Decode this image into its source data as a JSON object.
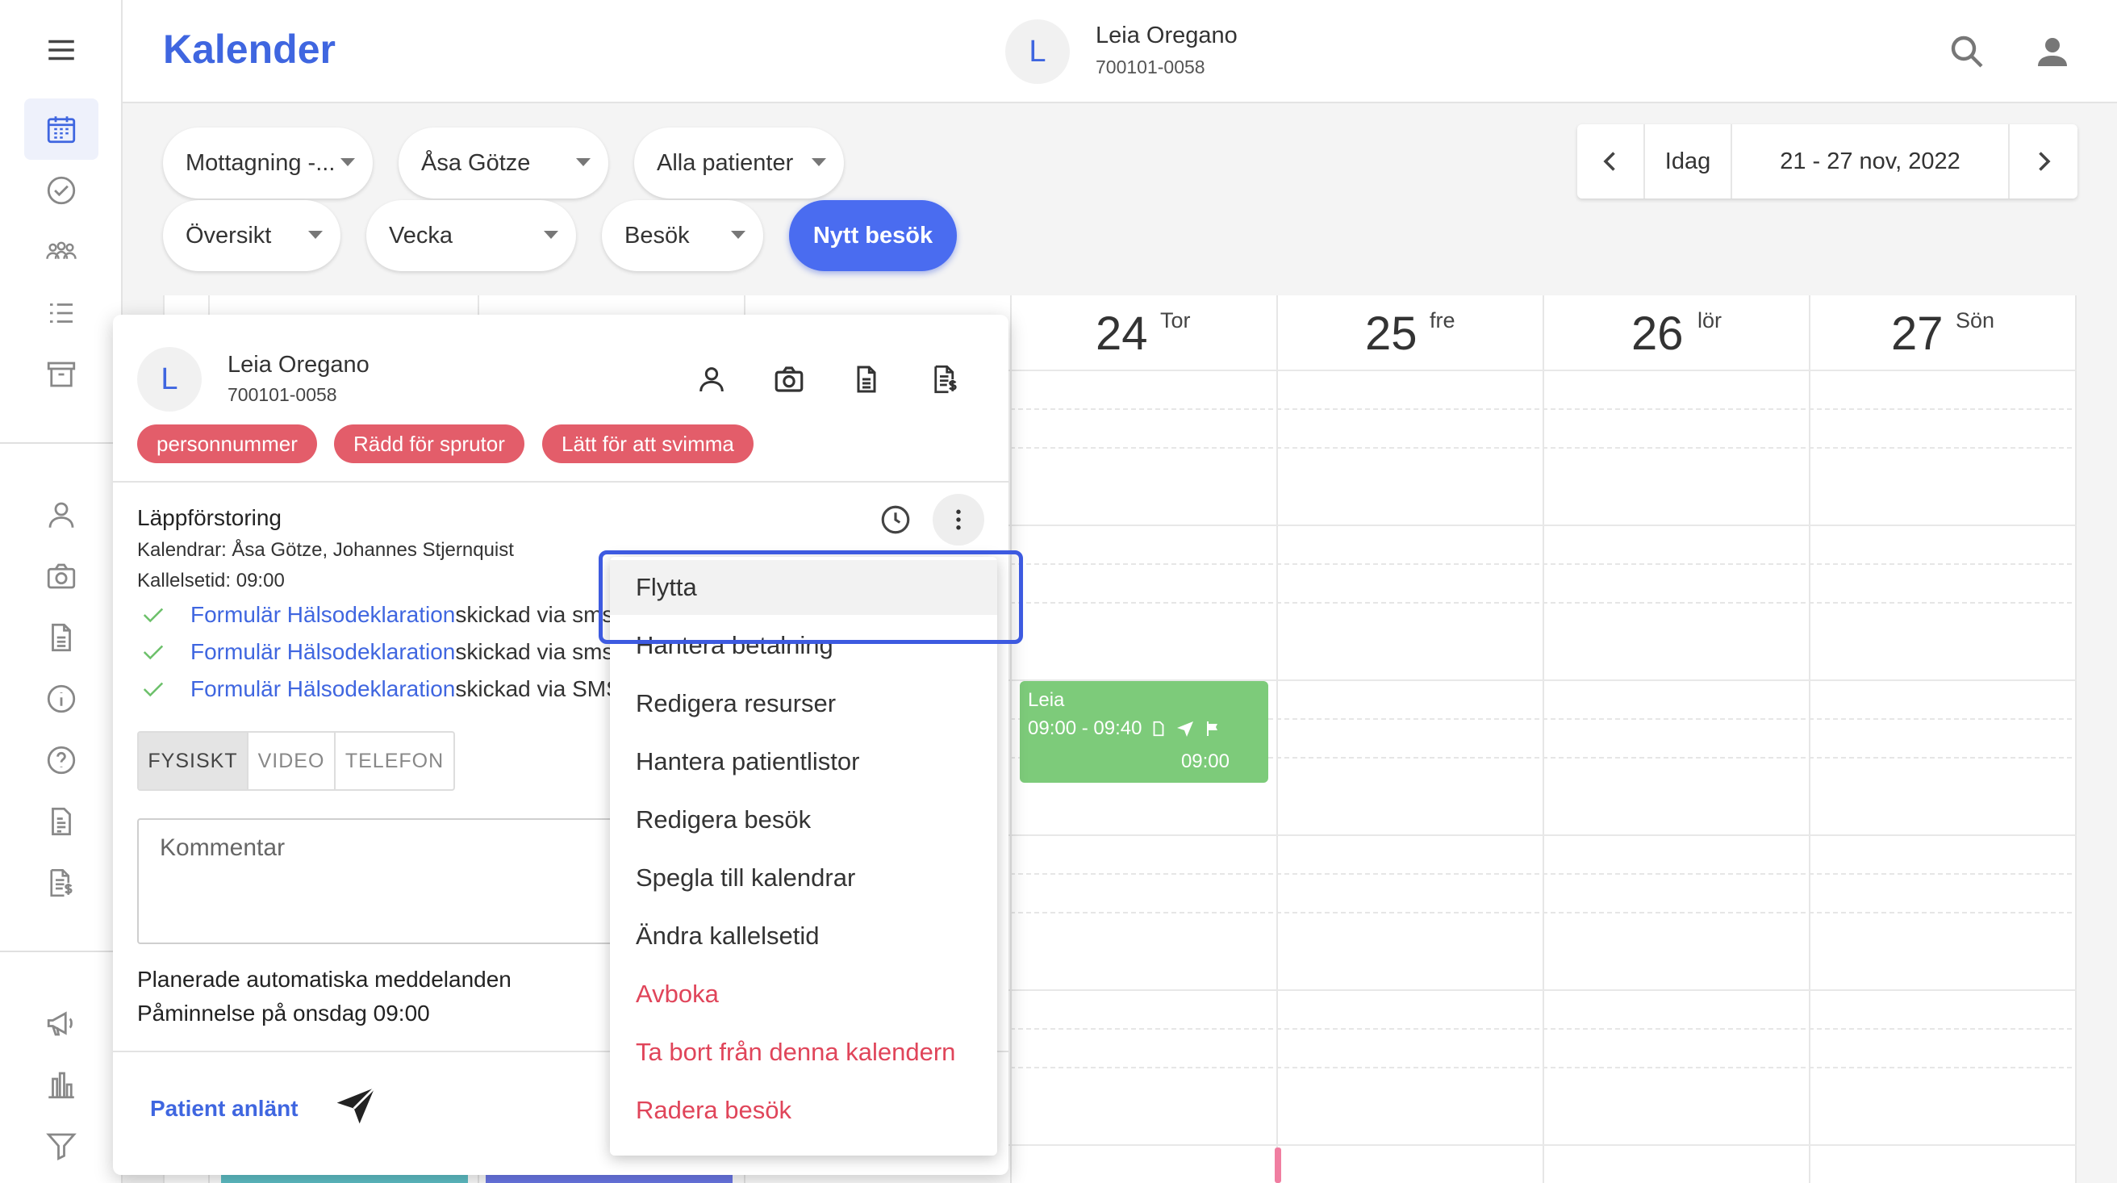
{
  "app": {
    "title": "Kalender"
  },
  "colors": {
    "accent": "#3f66e0",
    "primary_button": "#4a6cf0",
    "tag": "#e35d6a",
    "event": "#7dcb7a",
    "danger": "#e0455a",
    "highlight": "#3d5ae0"
  },
  "header": {
    "avatar_letter": "L",
    "patient_name": "Leia Oregano",
    "patient_id": "700101-0058"
  },
  "filters": {
    "row1": [
      "Mottagning -...",
      "Åsa Götze",
      "Alla patienter"
    ],
    "row2": [
      "Översikt",
      "Vecka",
      "Besök"
    ],
    "new_visit_label": "Nytt besök"
  },
  "date_nav": {
    "today_label": "Idag",
    "range": "21 - 27 nov, 2022"
  },
  "calendar": {
    "days": [
      {
        "num": "24",
        "name": "Tor"
      },
      {
        "num": "25",
        "name": "fre"
      },
      {
        "num": "26",
        "name": "lör"
      },
      {
        "num": "27",
        "name": "Sön"
      }
    ],
    "event": {
      "title": "Leia",
      "time": "09:00 - 09:40",
      "call_time": "09:00"
    }
  },
  "popover": {
    "avatar_letter": "L",
    "name": "Leia Oregano",
    "pnr": "700101-0058",
    "tags": [
      "personnummer",
      "Rädd för sprutor",
      "Lätt för att svimma"
    ],
    "visit_type": "Läppförstoring",
    "calendars": "Kalendrar: Åsa Götze, Johannes Stjernquist",
    "call_time": "Kallelsetid: 09:00",
    "forms": [
      {
        "link": "Formulär Hälsodeklaration",
        "suffix": " skickad via sms"
      },
      {
        "link": "Formulär Hälsodeklaration",
        "suffix": " skickad via sms"
      },
      {
        "link": "Formulär Hälsodeklaration",
        "suffix": "skickad via SMS"
      }
    ],
    "modes": [
      "FYSISKT",
      "VIDEO",
      "TELEFON"
    ],
    "comment_placeholder": "Kommentar",
    "planned_title": "Planerade automatiska meddelanden",
    "reminder": "Påminnelse på onsdag 09:00",
    "arrived_label": "Patient anlänt"
  },
  "menu": {
    "items": [
      "Flytta",
      "Hantera betalning",
      "Redigera resurser",
      "Hantera patientlistor",
      "Redigera besök",
      "Spegla till kalendrar",
      "Ändra kallelsetid"
    ],
    "danger_items": [
      "Avboka",
      "Ta bort från denna kalendern",
      "Radera besök"
    ]
  }
}
